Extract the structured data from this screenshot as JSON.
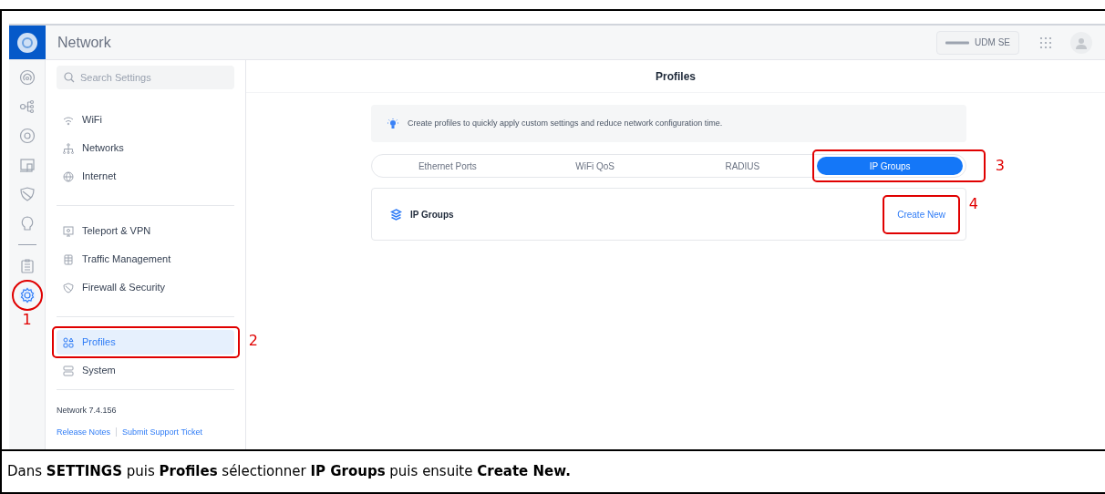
{
  "app": {
    "title": "Network",
    "device": "UDM SE"
  },
  "rail": [
    {
      "kind": "radar",
      "selected": false
    },
    {
      "kind": "topology",
      "selected": false
    },
    {
      "kind": "target",
      "selected": false
    },
    {
      "kind": "devices",
      "selected": false
    },
    {
      "kind": "shield",
      "selected": false
    },
    {
      "kind": "bulb",
      "selected": false
    },
    {
      "kind": "divider"
    },
    {
      "kind": "clipboard",
      "selected": false
    },
    {
      "kind": "gear",
      "selected": true,
      "callout": "1"
    }
  ],
  "search": {
    "placeholder": "Search Settings"
  },
  "sidebar": {
    "groups": [
      [
        {
          "kind": "wifi",
          "label": "WiFi",
          "selected": false
        },
        {
          "kind": "network",
          "label": "Networks",
          "selected": false
        },
        {
          "kind": "globe",
          "label": "Internet",
          "selected": false
        }
      ],
      [
        {
          "kind": "monitor",
          "label": "Teleport & VPN",
          "selected": false
        },
        {
          "kind": "traffic",
          "label": "Traffic Management",
          "selected": false
        },
        {
          "kind": "shield",
          "label": "Firewall & Security",
          "selected": false
        }
      ],
      [
        {
          "kind": "profiles",
          "label": "Profiles",
          "selected": true,
          "callout": "2"
        },
        {
          "kind": "system",
          "label": "System",
          "selected": false
        }
      ]
    ],
    "version": "Network 7.4.156",
    "links": [
      "Release Notes",
      "Submit Support Ticket"
    ]
  },
  "page_title": "Profiles",
  "banner": "Create profiles to quickly apply custom settings and reduce network configuration time.",
  "tabs": [
    {
      "label": "Ethernet Ports",
      "selected": false
    },
    {
      "label": "WiFi QoS",
      "selected": false
    },
    {
      "label": "RADIUS",
      "selected": false
    },
    {
      "label": "IP Groups",
      "selected": true,
      "callout": "3"
    }
  ],
  "section": {
    "title": "IP Groups",
    "action": "Create New",
    "action_callout": "4"
  },
  "caption": "Dans **SETTINGS** puis **Profiles** sélectionner **IP Groups** puis ensuite **Create New.**"
}
